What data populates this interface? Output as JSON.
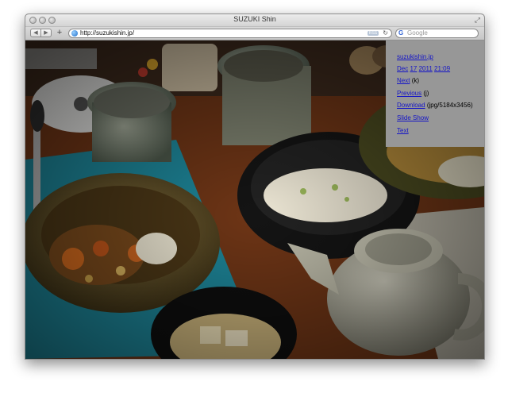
{
  "window": {
    "title": "SUZUKI Shin"
  },
  "toolbar": {
    "back_glyph": "◀",
    "forward_glyph": "▶",
    "new_tab_glyph": "+",
    "url": "http://suzukishin.jp/",
    "rss_label": "RSS",
    "reload_glyph": "↻",
    "search_engine_glyph": "G",
    "search_placeholder": "Google"
  },
  "panel": {
    "site_link": "suzukishin.jp",
    "date": {
      "month": "Dec",
      "day": "17",
      "year": "2011",
      "time": "21:09"
    },
    "next": {
      "label": "Next",
      "key": "(k)"
    },
    "previous": {
      "label": "Previous",
      "key": "(j)"
    },
    "download": {
      "label": "Download",
      "info": "(jpg/5184x3456)"
    },
    "slideshow_label": "Slide Show",
    "text_label": "Text"
  },
  "photo": {
    "subject_colors": {
      "table_cloth": "#7a3b16",
      "tray": "#1f8fa0",
      "bowl": "#6e5a2e",
      "rice": "#e8e2c4",
      "tea_pot": "#b9b8a6"
    }
  }
}
